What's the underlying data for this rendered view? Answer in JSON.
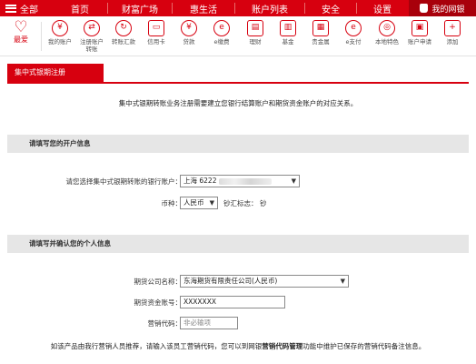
{
  "topnav": {
    "menu_label": "全部",
    "items": [
      "首页",
      "财富广场",
      "惠生活",
      "账户列表",
      "安全",
      "设置"
    ],
    "my_account": "我的网银",
    "colors": {
      "brand_red": "#d7000f",
      "dark_red": "#a8000b"
    }
  },
  "iconbar": {
    "favorite": {
      "label": "最爱",
      "icon": "heart-icon"
    },
    "items": [
      {
        "label": "我的账户",
        "icon": "yen-circle-icon"
      },
      {
        "label": "注册账户\n转账",
        "icon": "transfer-icon"
      },
      {
        "label": "转账汇款",
        "icon": "remit-icon"
      },
      {
        "label": "信用卡",
        "icon": "credit-card-icon"
      },
      {
        "label": "贷款",
        "icon": "loan-icon"
      },
      {
        "label": "e缴费",
        "icon": "payment-icon"
      },
      {
        "label": "理财",
        "icon": "wealth-icon"
      },
      {
        "label": "基金",
        "icon": "fund-chart-icon"
      },
      {
        "label": "贵金属",
        "icon": "gold-bar-icon"
      },
      {
        "label": "e支付",
        "icon": "epay-icon"
      },
      {
        "label": "本地特色",
        "icon": "local-icon"
      },
      {
        "label": "账户申请",
        "icon": "apply-icon"
      },
      {
        "label": "添加",
        "icon": "plus-icon"
      }
    ]
  },
  "page": {
    "tab_title": "集中式银期注册",
    "intro": "集中式银期转账业务注册需要建立您银行结算账户和期货资金账户的对应关系。",
    "section1": {
      "title": "请填写您的开户信息",
      "bank_account_label": "请您选择集中式银期转账的银行账户：",
      "bank_account_value": "上海 6222",
      "currency_label": "币种：",
      "currency_value": "人民币",
      "cash_flag_label": "钞汇标志：",
      "cash_flag_value": "钞"
    },
    "section2": {
      "title": "请填写并确认您的个人信息",
      "company_label": "期货公司名称：",
      "company_value": "东海期货有限责任公司(人民币)",
      "account_label": "期货资金账号：",
      "account_value": "XXXXXXX",
      "marketing_label": "营销代码：",
      "marketing_placeholder": "非必输项"
    },
    "note_pre": "如该产品由我行营销人员推荐，请输入该员工营销代码，您可以到网银",
    "note_bold": "营销代码管理",
    "note_post": "功能中维护已保存的营销代码备注信息。"
  }
}
